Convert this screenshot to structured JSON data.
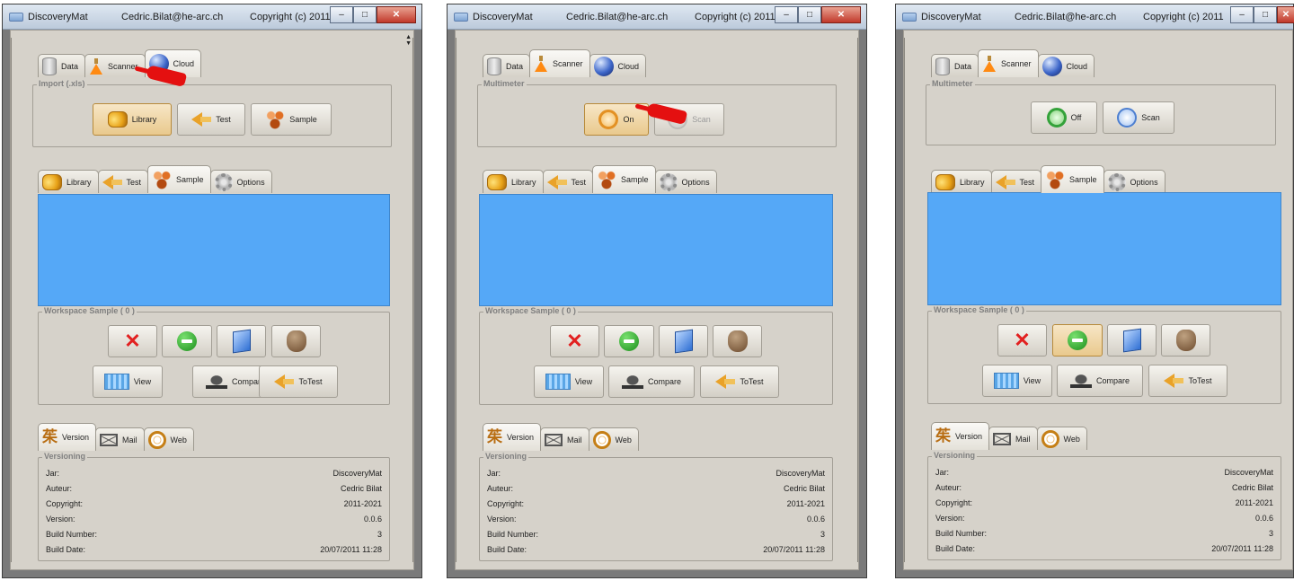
{
  "windows": [
    {
      "title": "DiscoveryMat",
      "user": "Cedric.Bilat@he-arc.ch",
      "copyright": "Copyright (c) 2011-...",
      "top_tabs": [
        {
          "label": "Data",
          "icon": "database-icon"
        },
        {
          "label": "Scanner",
          "icon": "flask-icon"
        },
        {
          "label": "Cloud",
          "icon": "cloud-icon",
          "active": true
        }
      ],
      "import_group": "Import (.xls)",
      "import_buttons": [
        {
          "label": "Library",
          "icon": "library-icon",
          "selected": true
        },
        {
          "label": "Test",
          "icon": "test-arrow-icon"
        },
        {
          "label": "Sample",
          "icon": "sample-icon"
        }
      ],
      "pointer_visible": true
    },
    {
      "title": "DiscoveryMat",
      "user": "Cedric.Bilat@he-arc.ch",
      "copyright": "Copyright (c) 2011-...",
      "top_tabs": [
        {
          "label": "Data",
          "icon": "database-icon"
        },
        {
          "label": "Scanner",
          "icon": "flask-icon",
          "active": true
        },
        {
          "label": "Cloud",
          "icon": "cloud-icon"
        }
      ],
      "multimeter_group": "Multimeter",
      "multimeter_buttons": [
        {
          "label": "On",
          "icon": "power-icon",
          "selected": true
        },
        {
          "label": "Scan",
          "icon": "scan-icon",
          "disabled": true
        }
      ],
      "pointer_visible": true
    },
    {
      "title": "DiscoveryMat",
      "user": "Cedric.Bilat@he-arc.ch",
      "copyright": "Copyright (c) 2011-...",
      "top_tabs": [
        {
          "label": "Data",
          "icon": "database-icon"
        },
        {
          "label": "Scanner",
          "icon": "flask-icon",
          "active": true
        },
        {
          "label": "Cloud",
          "icon": "cloud-icon"
        }
      ],
      "multimeter_group": "Multimeter",
      "multimeter_buttons": [
        {
          "label": "Off",
          "icon": "power-icon"
        },
        {
          "label": "Scan",
          "icon": "scan-icon"
        }
      ],
      "pointer_visible": false
    }
  ],
  "middle_tabs": [
    {
      "label": "Library",
      "icon": "library-icon"
    },
    {
      "label": "Test",
      "icon": "test-arrow-icon"
    },
    {
      "label": "Sample",
      "icon": "sample-icon",
      "active": true
    },
    {
      "label": "Options",
      "icon": "gear-icon"
    }
  ],
  "workspace": {
    "title": "Workspace Sample ( 0 )",
    "action_icons": [
      "delete-icon",
      "remove-icon",
      "select-icon",
      "hand-icon"
    ],
    "buttons": [
      {
        "label": "View",
        "icon": "view-icon"
      },
      {
        "label": "Compare",
        "icon": "compare-icon"
      },
      {
        "label": "ToTest",
        "icon": "test-arrow-icon"
      }
    ]
  },
  "bottom_tabs": [
    {
      "label": "Version",
      "icon": "version-icon",
      "active": true
    },
    {
      "label": "Mail",
      "icon": "mail-icon"
    },
    {
      "label": "Web",
      "icon": "web-icon"
    }
  ],
  "versioning": {
    "title": "Versioning",
    "rows": [
      {
        "key": "Jar:",
        "value": "DiscoveryMat"
      },
      {
        "key": "Auteur:",
        "value": "Cedric Bilat"
      },
      {
        "key": "Copyright:",
        "value": "2011-2021"
      },
      {
        "key": "Version:",
        "value": "0.0.6"
      },
      {
        "key": "Build Number:",
        "value": "3"
      },
      {
        "key": "Build Date:",
        "value": "20/07/2011 11:28"
      }
    ]
  }
}
